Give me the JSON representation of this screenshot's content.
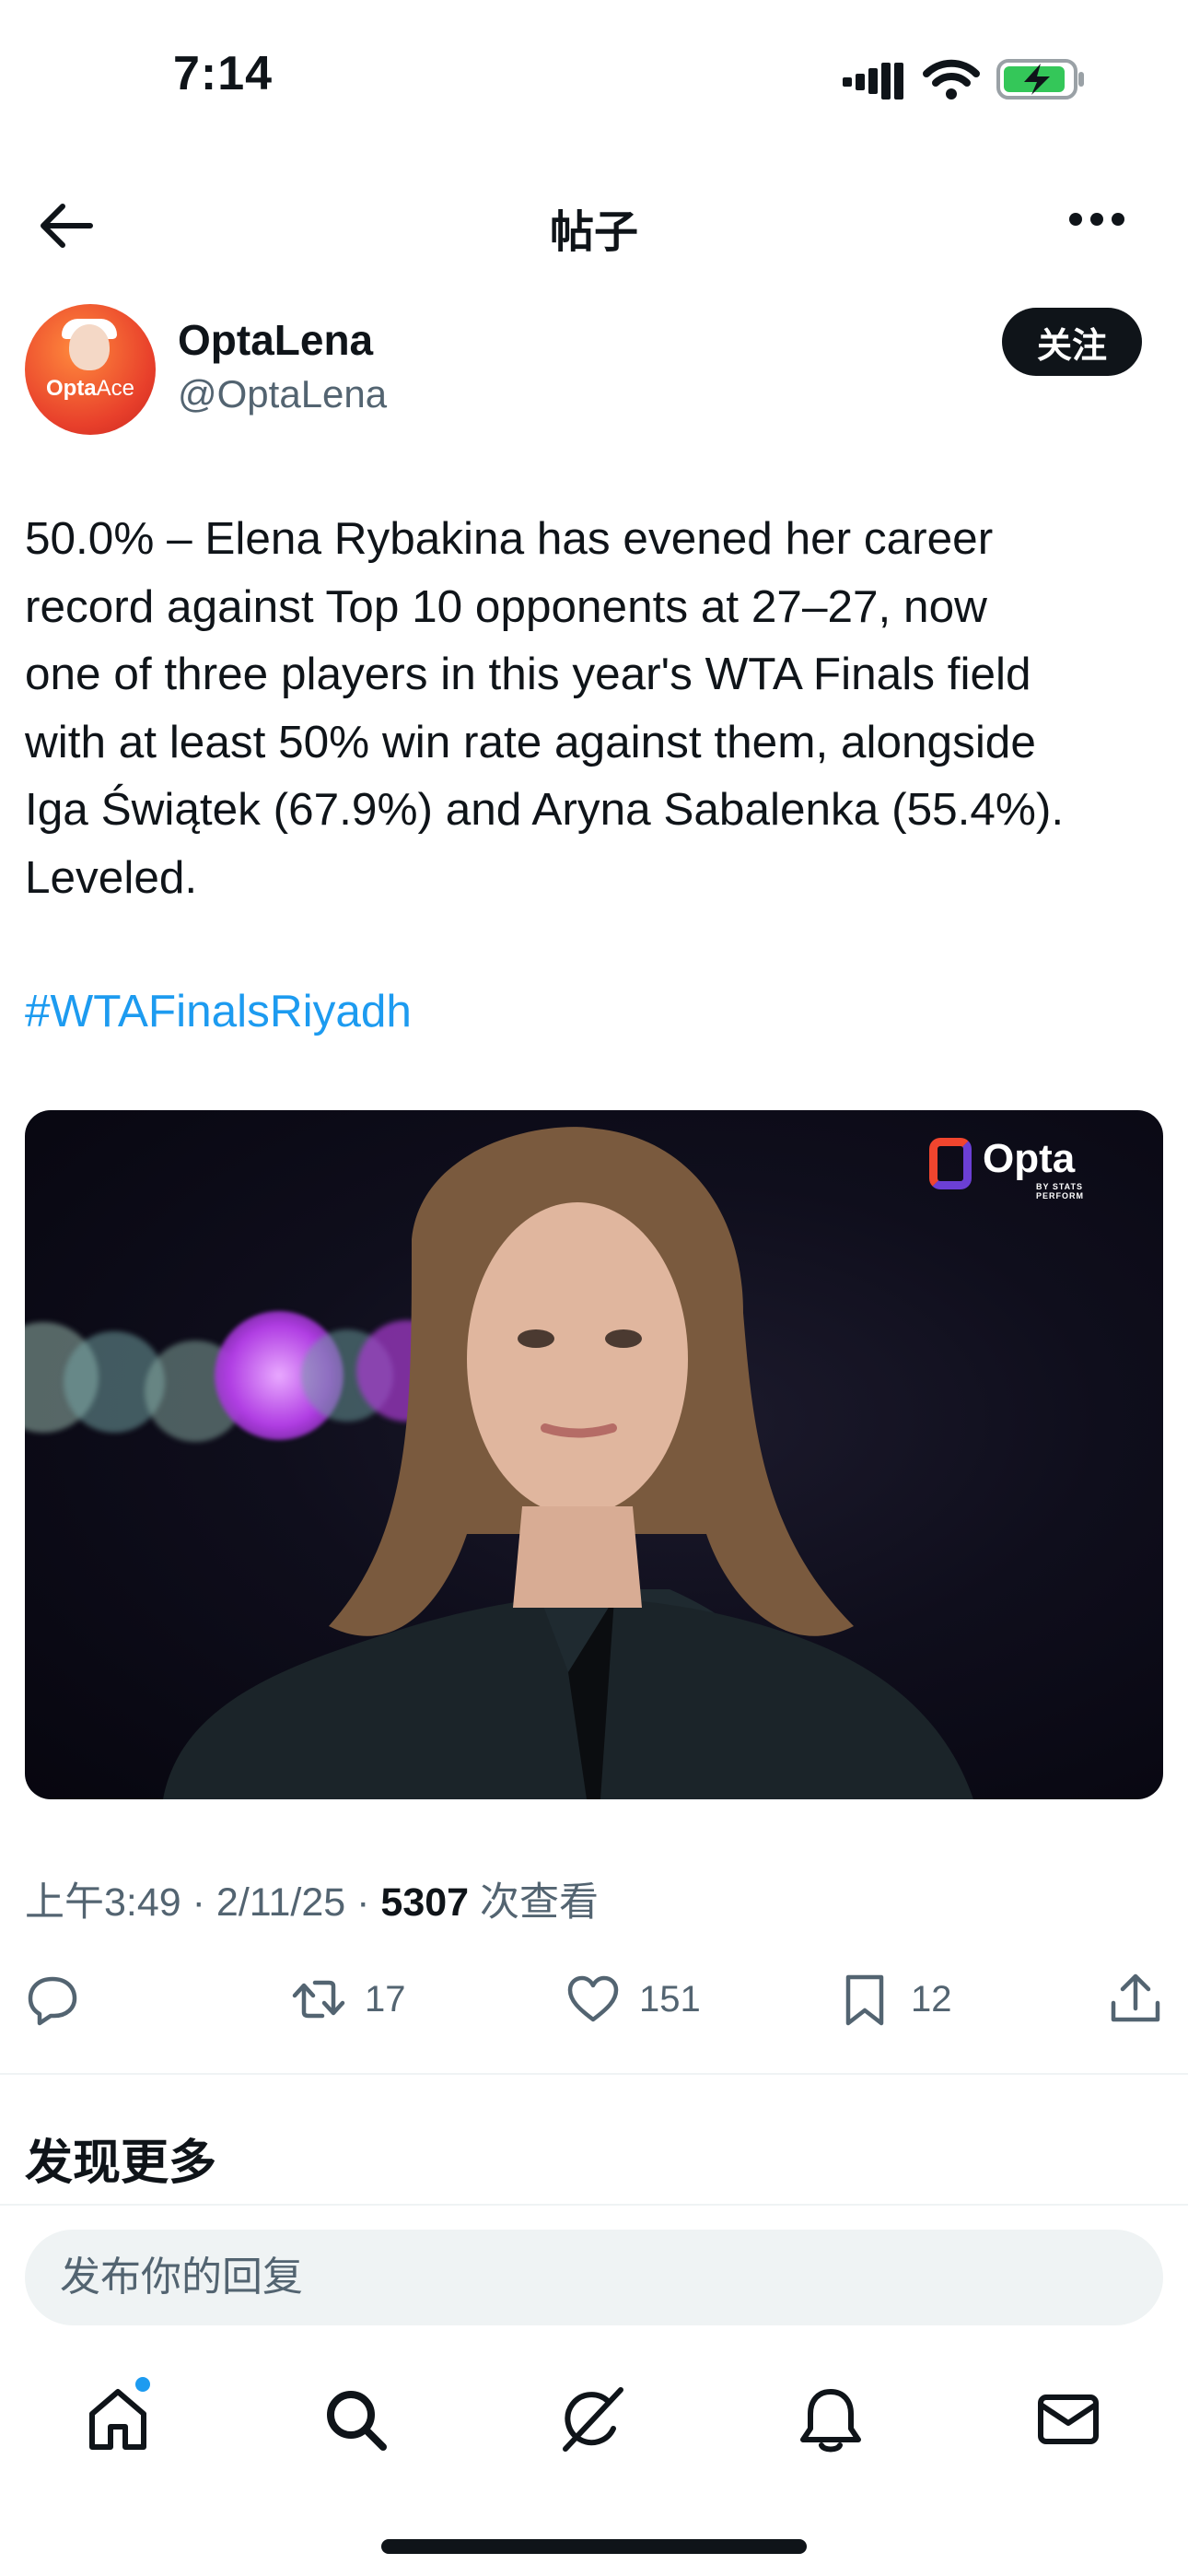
{
  "status_bar": {
    "time": "7:14"
  },
  "nav": {
    "title": "帖子"
  },
  "author": {
    "name": "OptaLena",
    "handle": "@OptaLena",
    "avatar_label_main": "Opta",
    "avatar_label_sub": "Ace",
    "follow_label": "关注"
  },
  "tweet": {
    "lines": [
      "50.0% – Elena Rybakina has evened her career",
      "record against Top 10 opponents at 27–27, now",
      "one of three players in this year's WTA Finals field",
      "with at least 50% win rate against them, alongside",
      "Iga Świątek (67.9%) and Aryna Sabalenka (55.4%).",
      "Leveled."
    ],
    "hashtag": "#WTAFinalsRiyadh"
  },
  "media": {
    "logo_text": "Opta",
    "logo_sub": "BY STATS PERFORM"
  },
  "meta": {
    "time": "上午3:49",
    "date": "2/11/25",
    "views": "5307",
    "views_label": "次查看"
  },
  "actions": {
    "retweets": "17",
    "likes": "151",
    "bookmarks": "12"
  },
  "discover": {
    "title": "发现更多"
  },
  "reply": {
    "placeholder": "发布你的回复"
  },
  "colors": {
    "accent": "#1d9bf0",
    "text": "#0f1419",
    "secondary": "#536471",
    "reply_bg": "#eff3f4"
  }
}
